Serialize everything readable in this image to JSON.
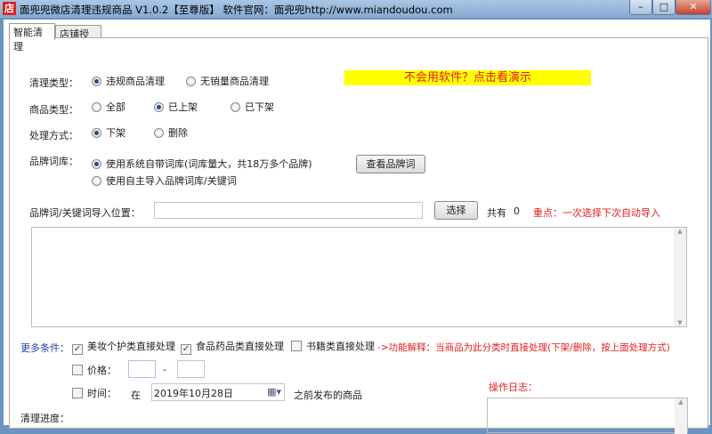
{
  "window": {
    "icon_text": "店",
    "title": "面兜兜微店清理违规商品 V1.0.2【至尊版】  软件官网：面兜兜http://www.miandoudou.com",
    "minimize": "–",
    "maximize": "□",
    "close": "✕"
  },
  "tabs": [
    "智能清理",
    "店铺授权"
  ],
  "clean_type": {
    "label": "清理类型：",
    "options": [
      "违规商品清理",
      "无销量商品清理"
    ],
    "selected": 0
  },
  "demo_banner": "不会用软件？点击看演示",
  "goods_type": {
    "label": "商品类型：",
    "options": [
      "全部",
      "已上架",
      "已下架"
    ],
    "selected": 1
  },
  "process": {
    "label": "处理方式：",
    "options": [
      "下架",
      "删除"
    ],
    "selected": 0
  },
  "brand_lib": {
    "label": "品牌词库：",
    "options": [
      "使用系统自带词库(词库量大，共18万多个品牌)",
      "使用自主导入品牌词库/关键词"
    ],
    "selected": 0,
    "view_button": "查看品牌词"
  },
  "import": {
    "label": "品牌词/关键词导入位置：",
    "value": "",
    "select_button": "选择",
    "count_label": "共有",
    "count": "0",
    "note": "重点：一次选择下次自动导入"
  },
  "more": {
    "label": "更多条件：",
    "checks": [
      {
        "label": "美妆个护类直接处理",
        "checked": true
      },
      {
        "label": "食品药品类直接处理",
        "checked": true
      },
      {
        "label": "书籍类直接处理",
        "checked": false
      }
    ],
    "explain": "->功能解释：当商品为此分类时直接处理(下架/删除，按上面处理方式)"
  },
  "price": {
    "label": "价格：",
    "checked": false,
    "min": "",
    "max": "",
    "dash": "-"
  },
  "time": {
    "label": "时间：",
    "checked": false,
    "prefix": "在",
    "date": "2019年10月28日",
    "suffix": "之前发布的商品"
  },
  "log_label": "操作日志：",
  "progress_label": "清理进度："
}
